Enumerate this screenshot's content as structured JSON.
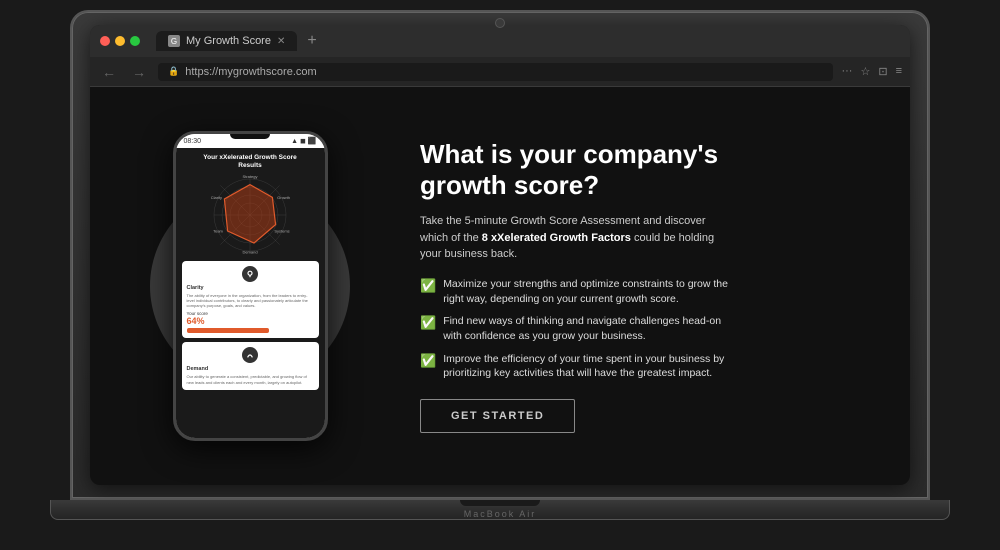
{
  "browser": {
    "tab_title": "My Growth Score",
    "tab_close": "✕",
    "tab_new": "+",
    "url": "https://mygrowthscore.com",
    "nav_back": "←",
    "nav_forward": "→",
    "traffic_lights": [
      "red",
      "yellow",
      "green"
    ]
  },
  "phone": {
    "status_time": "08:30",
    "signal_icon": "▲",
    "screen_title": "Your xXelerated Growth Score",
    "screen_subtitle": "Results",
    "card1": {
      "section_title": "Clarity",
      "body_text": "The ability of everyone in the organization, from the leaders to entry-level individual contributors, to clearly and passionately articulate the company's purpose, goals, and values.",
      "score_label": "Your score",
      "score_value": "64%"
    },
    "card2": {
      "section_title": "Demand",
      "body_text": "Our ability to generate a consistent, predictable, and growing flow of new leads and clients each and every month, largely on autopilot."
    }
  },
  "hero": {
    "heading_line1": "What is your company's",
    "heading_line2": "growth score?",
    "body_text": "Take the 5-minute Growth Score Assessment and discover which of the ",
    "body_bold": "8 xXelerated Growth Factors",
    "body_text2": " could be holding your business back.",
    "bullets": [
      "Maximize your strengths and optimize constraints to grow the right way, depending on your current growth score.",
      "Find new ways of thinking and navigate challenges head-on with confidence as you grow your business.",
      "Improve the efficiency of your time spent in your business by prioritizing key activities that will have the greatest impact."
    ],
    "cta_label": "GET STARTED"
  },
  "macbook": {
    "brand_label": "MacBook Air"
  }
}
